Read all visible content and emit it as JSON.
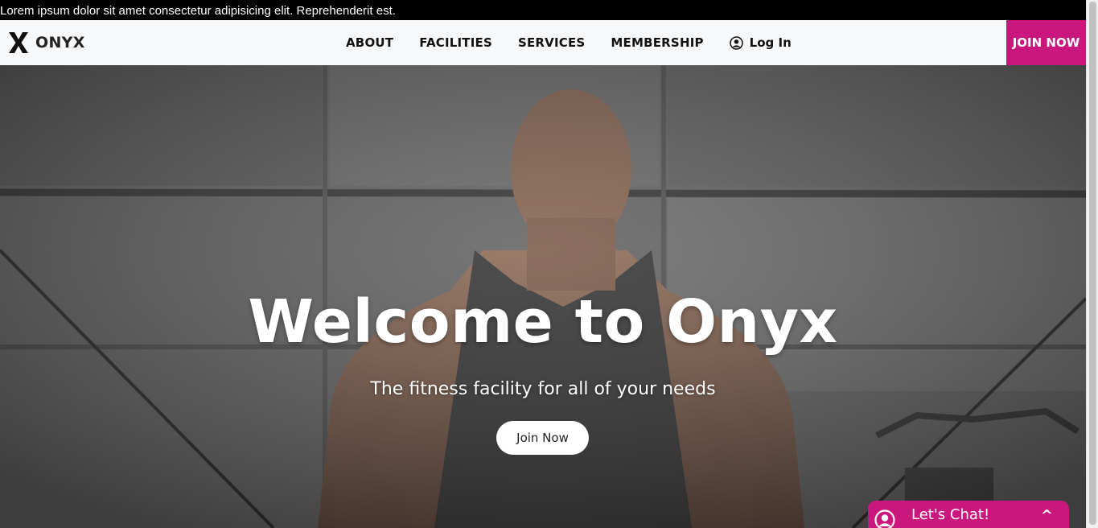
{
  "announcement": "Lorem ipsum dolor sit amet consectetur adipisicing elit. Reprehenderit est.",
  "brand": {
    "name": "ONYX",
    "logo_icon": "x-logo-icon"
  },
  "nav": {
    "links": [
      "ABOUT",
      "FACILITIES",
      "SERVICES",
      "MEMBERSHIP"
    ],
    "login_label": "Log In",
    "login_icon": "user-circle-icon",
    "join_label": "JOIN NOW"
  },
  "hero": {
    "title": "Welcome to Onyx",
    "subtitle": "The fitness facility for all of your needs",
    "button_label": "Join Now"
  },
  "chat": {
    "label": "Let's Chat!",
    "caret": "^",
    "icon": "user-circle-icon"
  },
  "colors": {
    "accent": "#c9177e",
    "announce_bg": "#000000",
    "nav_bg": "#f7f8fa"
  }
}
